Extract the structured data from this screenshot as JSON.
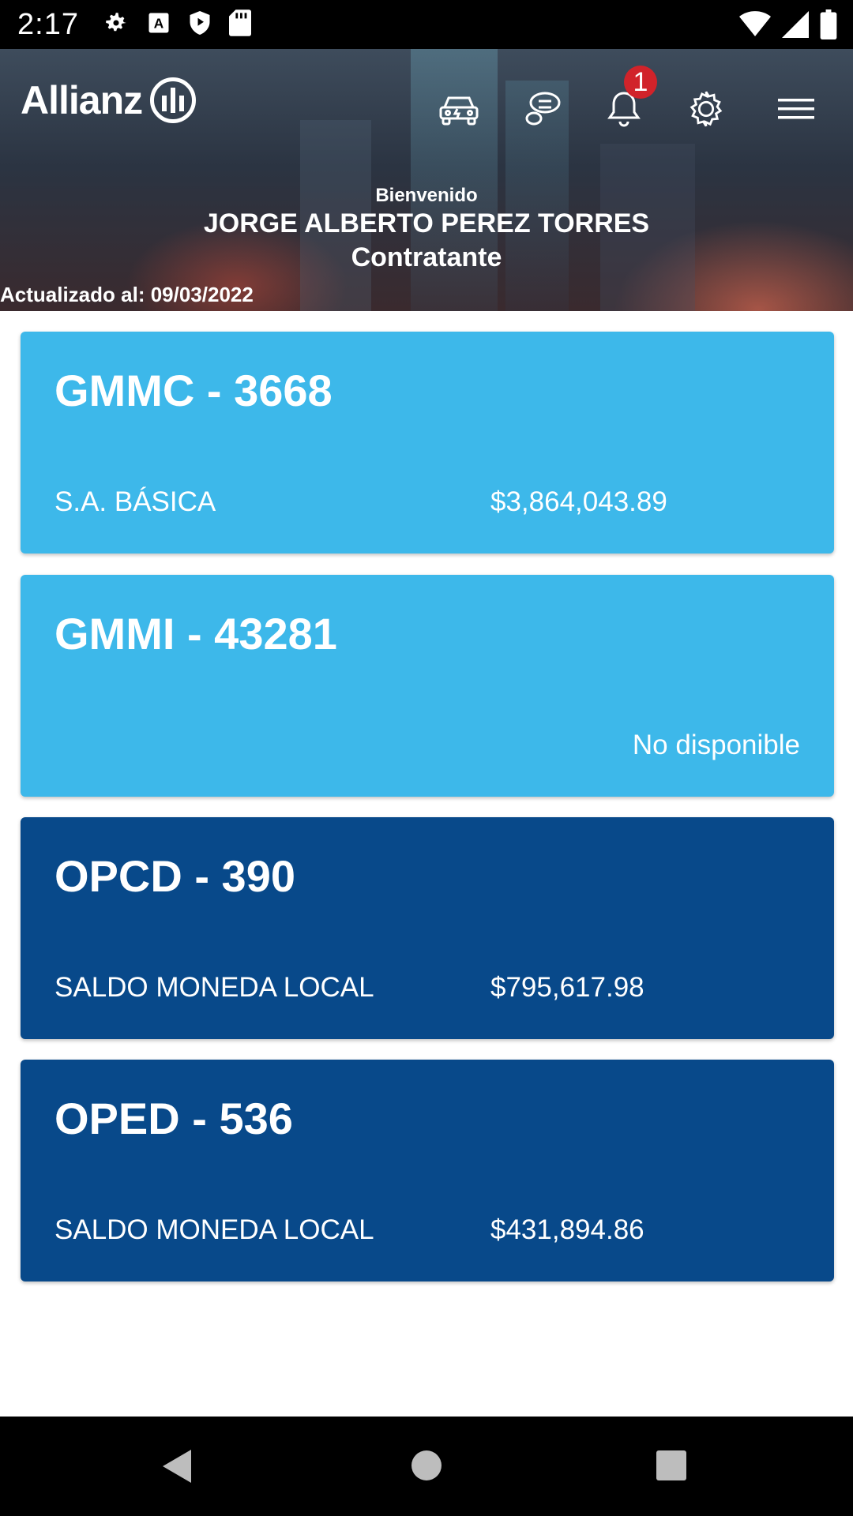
{
  "status_bar": {
    "time": "2:17",
    "icons": [
      "settings-icon",
      "keyboard-a-icon",
      "shield-icon",
      "sd-card-icon",
      "wifi-icon",
      "signal-icon",
      "battery-icon"
    ]
  },
  "header": {
    "logo_text": "Allianz",
    "icons": [
      "car-icon",
      "chat-icon",
      "bell-icon",
      "gear-icon",
      "menu-icon"
    ],
    "notification_count": "1",
    "welcome_label": "Bienvenido",
    "user_name": "JORGE ALBERTO PEREZ TORRES",
    "user_role": "Contratante",
    "updated_text": "Actualizado al: 09/03/2022"
  },
  "policies": [
    {
      "title": "GMMC - 3668",
      "label": "S.A. BÁSICA",
      "amount": "$3,864,043.89",
      "color": "#3db8ea"
    },
    {
      "title": "GMMI - 43281",
      "label": "",
      "amount": "No disponible",
      "color": "#3db8ea"
    },
    {
      "title": "OPCD - 390",
      "label": "SALDO MONEDA LOCAL",
      "amount": "$795,617.98",
      "color": "#08498a"
    },
    {
      "title": "OPED - 536",
      "label": "SALDO MONEDA LOCAL",
      "amount": "$431,894.86",
      "color": "#08498a"
    }
  ],
  "nav_bar": {
    "buttons": [
      "back-icon",
      "home-icon",
      "recents-icon"
    ]
  }
}
